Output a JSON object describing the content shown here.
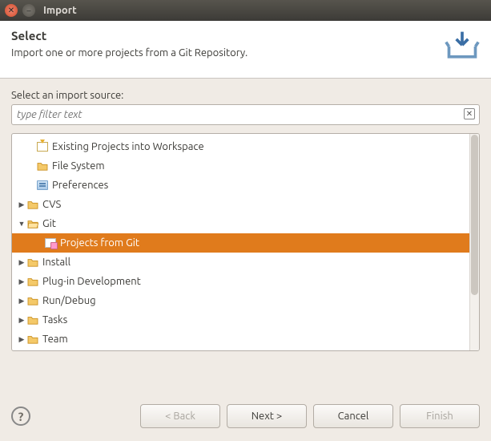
{
  "window": {
    "title": "Import"
  },
  "banner": {
    "heading": "Select",
    "description": "Import one or more projects from a Git Repository."
  },
  "filter": {
    "label": "Select an import source:",
    "placeholder": "type filter text",
    "value": ""
  },
  "tree": {
    "general_children": [
      {
        "label": "Existing Projects into Workspace",
        "icon": "import"
      },
      {
        "label": "File System",
        "icon": "folder-closed"
      },
      {
        "label": "Preferences",
        "icon": "pref"
      }
    ],
    "nodes": [
      {
        "label": "CVS",
        "expanded": false
      },
      {
        "label": "Git",
        "expanded": true,
        "children": [
          {
            "label": "Projects from Git",
            "icon": "git-item",
            "selected": true
          }
        ]
      },
      {
        "label": "Install",
        "expanded": false
      },
      {
        "label": "Plug-in Development",
        "expanded": false
      },
      {
        "label": "Run/Debug",
        "expanded": false
      },
      {
        "label": "Tasks",
        "expanded": false
      },
      {
        "label": "Team",
        "expanded": false
      }
    ]
  },
  "buttons": {
    "back": "< Back",
    "next": "Next >",
    "cancel": "Cancel",
    "finish": "Finish"
  }
}
